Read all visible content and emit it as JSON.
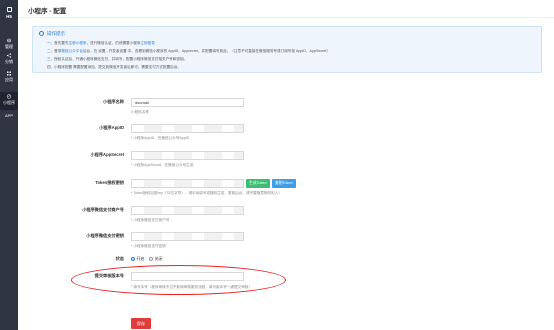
{
  "rail": {
    "brand": "H5",
    "items": [
      {
        "label": "管理"
      },
      {
        "label": "分销"
      },
      {
        "label": "应用"
      },
      {
        "label": "小程序"
      },
      {
        "label": "APP"
      }
    ]
  },
  "submenu": {
    "items": [
      {
        "label": "小程序设置"
      },
      {
        "label": "商家信息"
      },
      {
        "label": "小程序广告位"
      },
      {
        "label": "小程序直播"
      },
      {
        "label": "可助社媒体"
      },
      {
        "label": "自定义工商栏"
      }
    ]
  },
  "header": {
    "title": "小程序 - 配置"
  },
  "tips": {
    "title": "操作提示",
    "lines": [
      {
        "pre": "一、首先要先",
        "link1": "注册小程序",
        "mid": "，进行微信认证，仍然需要小程序",
        "link2": "立即登录",
        "post": ""
      },
      {
        "pre": "二、登录",
        "link1": "微信公众平台",
        "mid": "后台，在 设置 - 开发者设置 中，查看到微信小程序的 AppID、Appsecret，并配置填写到此。（注意不可直接在微信服务号或订阅号找 AppID、AppSecret）",
        "link2": "",
        "post": ""
      },
      {
        "pre": "三、授权认证后，开通小程序微信支付，并填写，配置小程序微信支付相关户号和密钥。",
        "link1": "",
        "mid": "",
        "link2": "",
        "post": ""
      },
      {
        "pre": "四、小程序配置 需要配置添加，提交到微信开发者后即可，需要支付方式配置后台。",
        "link1": "",
        "mid": "",
        "link2": "",
        "post": ""
      }
    ]
  },
  "form": {
    "name": {
      "label": "小程序名称",
      "value": "dsomall",
      "hint": "小程序名称"
    },
    "appid": {
      "label": "小程序AppID",
      "value": "",
      "hint": "* 小程序AppID，在微信公众号AppID"
    },
    "secret": {
      "label": "小程序AppSecret",
      "value": "",
      "hint": "* 小程序AppSecret，在微信公众号生成"
    },
    "token": {
      "label": "Token授权密钥",
      "value": "",
      "hint": "* Token授权加密key（32位字符），请手动填写或随机生成，更新后台，请不要随意修改别人！",
      "btn_generate": "生成Token",
      "btn_copy": "复制Token"
    },
    "mchid": {
      "label": "小程序微信支付商户号",
      "value": "",
      "hint": "* 小程序微信支付商户号"
    },
    "paykey": {
      "label": "小程序微信支付密钥",
      "value": "",
      "hint": "* 小程序微信支付密钥"
    },
    "status": {
      "label": "状态",
      "options": [
        "开启",
        "关闭"
      ],
      "selected": "开启"
    },
    "version": {
      "label": "提交审核版本号",
      "value": "",
      "hint": "* 填写本号（程序审核不过不影响审核服务流程，填写版本号一键提交审核）"
    },
    "save_label": "保存"
  },
  "colors": {
    "accent": "#e23b3b",
    "link": "#2a7ed8",
    "rail": "#2f3542",
    "submenu": "#4a4f5a"
  }
}
